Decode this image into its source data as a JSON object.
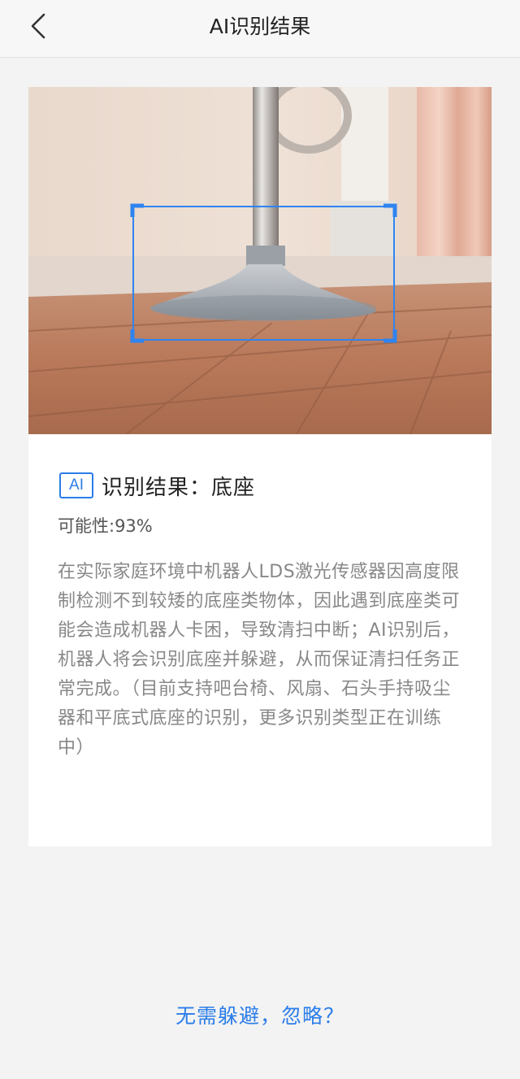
{
  "header": {
    "title": "AI识别结果"
  },
  "result": {
    "badge": "AI",
    "label": "识别结果：底座",
    "probability": "可能性:93%",
    "description": "在实际家庭环境中机器人LDS激光传感器因高度限制检测不到较矮的底座类物体，因此遇到底座类可能会造成机器人卡困，导致清扫中断；AI识别后，机器人将会识别底座并躲避，从而保证清扫任务正常完成。（目前支持吧台椅、风扇、石头手持吸尘器和平底式底座的识别，更多识别类型正在训练中）"
  },
  "footer": {
    "ignore_link": "无需躲避，忽略？"
  },
  "colors": {
    "accent": "#2b7de9",
    "background": "#f3f3f3",
    "card": "#ffffff"
  },
  "icons": {
    "back": "chevron-left-icon"
  }
}
